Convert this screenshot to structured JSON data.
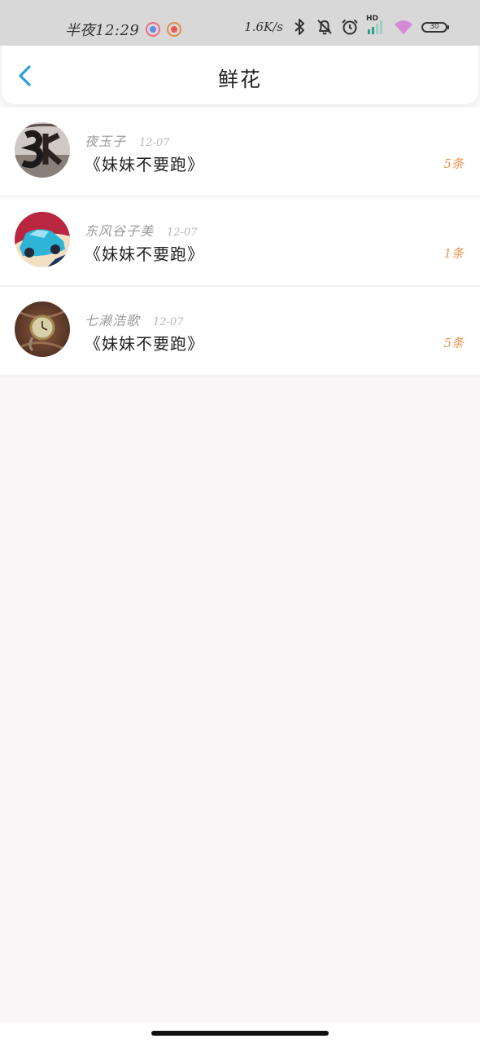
{
  "status_bar": {
    "time": "半夜12:29",
    "network_speed": "1.6K/s",
    "wifi_label": "HD",
    "battery": "30",
    "icons": [
      "bluetooth-icon",
      "mute-bell-icon",
      "alarm-icon",
      "signal-icon",
      "wifi-icon",
      "battery-icon"
    ]
  },
  "header": {
    "title": "鲜花",
    "back_icon": "chevron-left-icon",
    "accent_color": "#2a9fd8"
  },
  "gifts": [
    {
      "username": "夜玉子",
      "date": "12-07",
      "gift": "《妹妹不要跑》",
      "count": "5条",
      "avatar": "avatar-number-art"
    },
    {
      "username": "东风谷子美",
      "date": "12-07",
      "gift": "《妹妹不要跑》",
      "count": "1条",
      "avatar": "avatar-blue-toy-car"
    },
    {
      "username": "七濑浩歌",
      "date": "12-07",
      "gift": "《妹妹不要跑》",
      "count": "5条",
      "avatar": "avatar-pocket-watch"
    }
  ],
  "colors": {
    "count_color": "#e9944d",
    "username_color": "#9a9a9a",
    "page_background": "#f8f6f7"
  }
}
